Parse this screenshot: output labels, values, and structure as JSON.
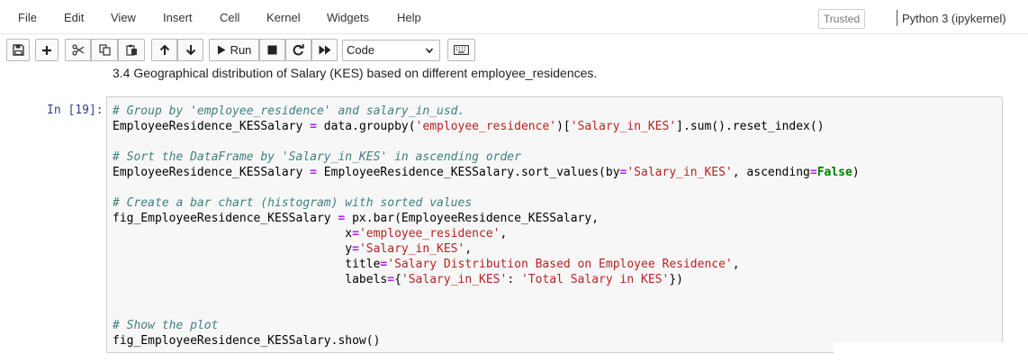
{
  "menubar": {
    "items": [
      "File",
      "Edit",
      "View",
      "Insert",
      "Cell",
      "Kernel",
      "Widgets",
      "Help"
    ],
    "trusted": "Trusted",
    "kernel": "Python 3 (ipykernel)"
  },
  "toolbar": {
    "run_label": "Run",
    "cell_type": "Code",
    "icons": [
      "save-icon",
      "plus-icon",
      "scissors-icon",
      "copy-icon",
      "paste-icon",
      "arrow-up-icon",
      "arrow-down-icon",
      "play-icon",
      "stop-icon",
      "restart-icon",
      "fast-forward-icon",
      "keyboard-icon"
    ]
  },
  "markdown": {
    "heading": "3.4 Geographical distribution of Salary (KES) based on different employee_residences."
  },
  "cell": {
    "prompt": "In [19]:",
    "lines": [
      [
        {
          "t": "# Group by 'employee_residence' and salary_in_usd.",
          "c": "cm"
        }
      ],
      [
        {
          "t": "EmployeeResidence_KESSalary ",
          "c": ""
        },
        {
          "t": "=",
          "c": "op"
        },
        {
          "t": " data.groupby(",
          "c": ""
        },
        {
          "t": "'employee_residence'",
          "c": "st"
        },
        {
          "t": ")[",
          "c": ""
        },
        {
          "t": "'Salary_in_KES'",
          "c": "st"
        },
        {
          "t": "].sum().reset_index()",
          "c": ""
        }
      ],
      [],
      [
        {
          "t": "# Sort the DataFrame by 'Salary_in_KES' in ascending order",
          "c": "cm"
        }
      ],
      [
        {
          "t": "EmployeeResidence_KESSalary ",
          "c": ""
        },
        {
          "t": "=",
          "c": "op"
        },
        {
          "t": " EmployeeResidence_KESSalary.sort_values(by",
          "c": ""
        },
        {
          "t": "=",
          "c": "op"
        },
        {
          "t": "'Salary_in_KES'",
          "c": "st"
        },
        {
          "t": ", ascending",
          "c": ""
        },
        {
          "t": "=",
          "c": "op"
        },
        {
          "t": "False",
          "c": "kw"
        },
        {
          "t": ")",
          "c": ""
        }
      ],
      [],
      [
        {
          "t": "# Create a bar chart (histogram) with sorted values",
          "c": "cm"
        }
      ],
      [
        {
          "t": "fig_EmployeeResidence_KESSalary ",
          "c": ""
        },
        {
          "t": "=",
          "c": "op"
        },
        {
          "t": " px.bar(EmployeeResidence_KESSalary,",
          "c": ""
        }
      ],
      [
        {
          "t": "                                 x",
          "c": ""
        },
        {
          "t": "=",
          "c": "op"
        },
        {
          "t": "'employee_residence'",
          "c": "st"
        },
        {
          "t": ",",
          "c": ""
        }
      ],
      [
        {
          "t": "                                 y",
          "c": ""
        },
        {
          "t": "=",
          "c": "op"
        },
        {
          "t": "'Salary_in_KES'",
          "c": "st"
        },
        {
          "t": ",",
          "c": ""
        }
      ],
      [
        {
          "t": "                                 title",
          "c": ""
        },
        {
          "t": "=",
          "c": "op"
        },
        {
          "t": "'Salary Distribution Based on Employee Residence'",
          "c": "st"
        },
        {
          "t": ",",
          "c": ""
        }
      ],
      [
        {
          "t": "                                 labels",
          "c": ""
        },
        {
          "t": "=",
          "c": "op"
        },
        {
          "t": "{",
          "c": ""
        },
        {
          "t": "'Salary_in_KES'",
          "c": "st"
        },
        {
          "t": ": ",
          "c": ""
        },
        {
          "t": "'Total Salary in KES'",
          "c": "st"
        },
        {
          "t": "})",
          "c": ""
        }
      ],
      [],
      [],
      [
        {
          "t": "# Show the plot",
          "c": "cm"
        }
      ],
      [
        {
          "t": "fig_EmployeeResidence_KESSalary.show()",
          "c": ""
        }
      ]
    ]
  }
}
